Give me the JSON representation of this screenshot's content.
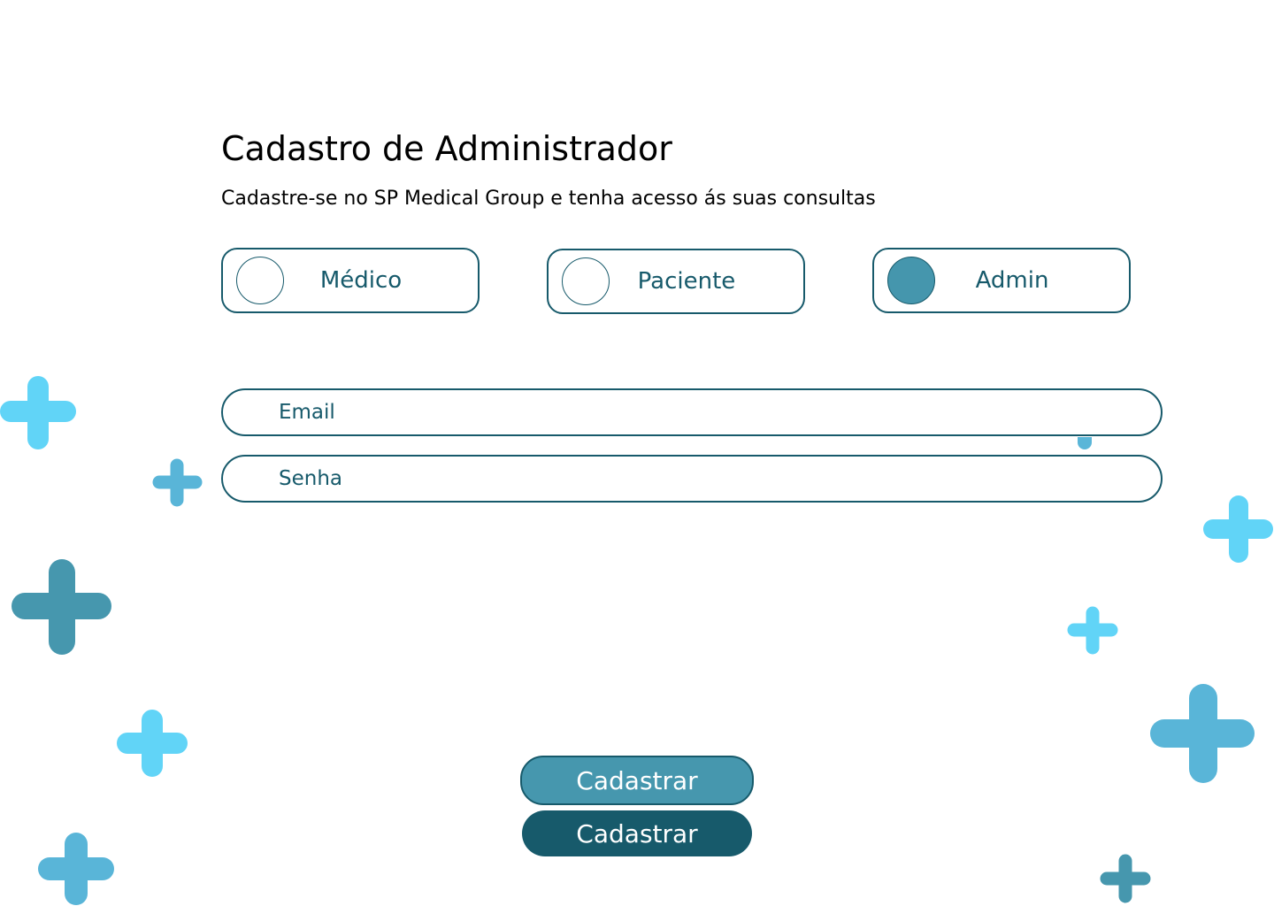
{
  "form": {
    "title": "Cadastro de Administrador",
    "subtitle": "Cadastre-se no SP Medical Group e tenha acesso ás suas consultas"
  },
  "roles": [
    {
      "label": "Médico",
      "selected": false
    },
    {
      "label": "Paciente",
      "selected": false
    },
    {
      "label": "Admin",
      "selected": true
    }
  ],
  "fields": {
    "email_placeholder": "Email",
    "password_placeholder": "Senha"
  },
  "buttons": {
    "primary_label": "Cadastrar",
    "secondary_label": "Cadastrar"
  },
  "colors": {
    "primary_dark": "#175a6b",
    "primary": "#4697ae",
    "accent_light": "#61d4f7",
    "accent_mid": "#59b5d8",
    "text": "#000000"
  },
  "decorations": {
    "icon": "plus-icon"
  }
}
